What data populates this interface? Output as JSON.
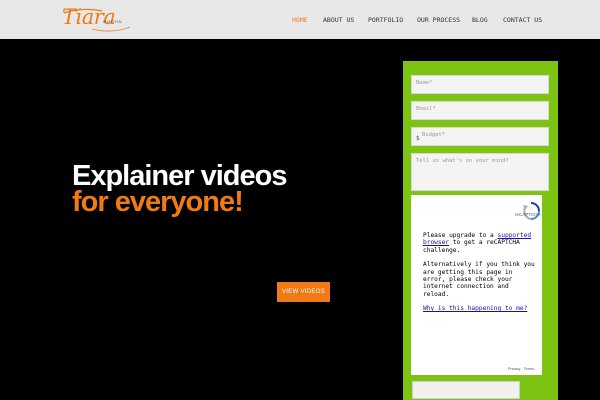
{
  "brand": {
    "logo_text": "Tiara",
    "logo_sub": "MOTION"
  },
  "nav": {
    "items": [
      {
        "label": "HOME",
        "active": true
      },
      {
        "label": "ABOUT US",
        "active": false
      },
      {
        "label": "PORTFOLIO",
        "active": false
      },
      {
        "label": "OUR PROCESS",
        "active": false
      },
      {
        "label": "BLOG",
        "active": false
      },
      {
        "label": "CONTACT US",
        "active": false
      }
    ]
  },
  "hero": {
    "line1": "Explainer videos",
    "line2": "for everyone!",
    "cta_label": "VIEW VIDEOS"
  },
  "form": {
    "name_placeholder": "Name*",
    "email_placeholder": "Email*",
    "currency_symbol": "$",
    "budget_placeholder": "Budget*",
    "message_placeholder": "Tell us what's on your mind?"
  },
  "recaptcha": {
    "brand": "reCAPTCHA",
    "msg_before_link": "Please upgrade to a ",
    "link_supported": "supported browser",
    "msg_after_link": " to get a reCAPTCHA challenge.",
    "msg_alt": "Alternatively if you think you are getting this page in error, please check your internet connection and reload.",
    "link_why": "Why is this happening to me?",
    "footer": "Privacy - Terms"
  },
  "colors": {
    "accent": "#f07a14",
    "panel_green": "#7dc412",
    "background": "#000000",
    "topbar": "#e8e8e8"
  }
}
